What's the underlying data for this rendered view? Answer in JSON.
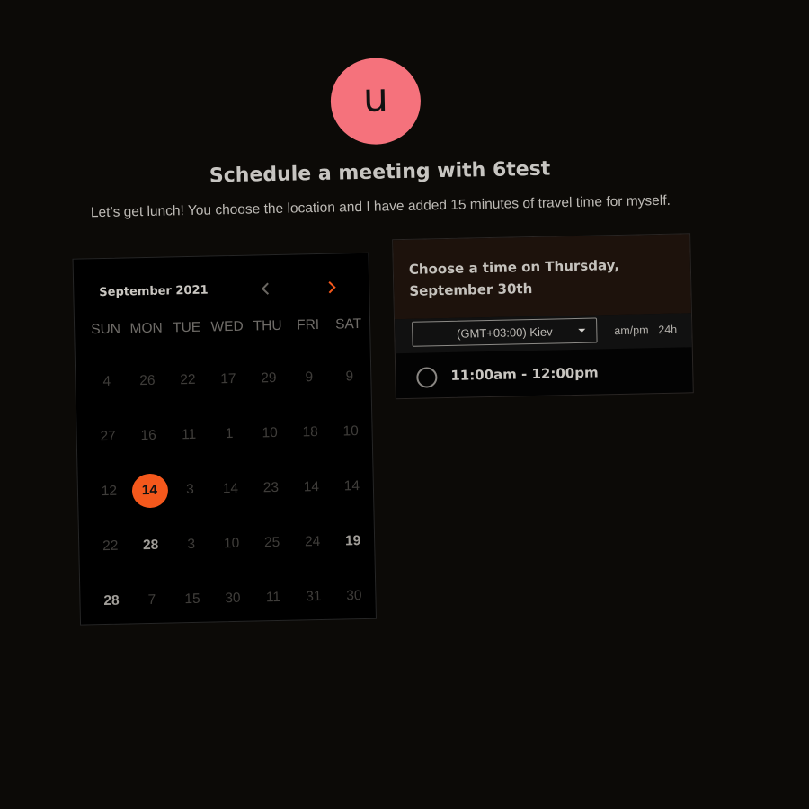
{
  "profile": {
    "avatar_letter": "u",
    "avatar_color": "#f5727c"
  },
  "header": {
    "title": "Schedule a meeting with 6test",
    "description": "Let’s get lunch! You choose the location and I have added 15 minutes of travel time for myself."
  },
  "calendar": {
    "month_label": "September 2021",
    "prev_icon": "chevron-left-icon",
    "next_icon": "chevron-right-icon",
    "accent_color": "#f4581c",
    "weekdays": [
      "SUN",
      "MON",
      "TUE",
      "WED",
      "THU",
      "FRI",
      "SAT"
    ],
    "weeks": [
      [
        "4",
        "26",
        "22",
        "17",
        "29",
        "9",
        "9"
      ],
      [
        "27",
        "16",
        "11",
        "1",
        "10",
        "18",
        "10"
      ],
      [
        "12",
        "14",
        "3",
        "14",
        "23",
        "14",
        "14"
      ],
      [
        "22",
        "28",
        "3",
        "10",
        "25",
        "24",
        "19"
      ],
      [
        "28",
        "7",
        "15",
        "30",
        "11",
        "31",
        "30"
      ]
    ],
    "selected_day": "14"
  },
  "time_picker": {
    "heading": "Choose a time on Thursday, September 30th",
    "timezone": "(GMT+03:00) Kiev",
    "format_ampm": "am/pm",
    "format_24h": "24h",
    "slots": [
      "11:00am - 12:00pm"
    ]
  }
}
